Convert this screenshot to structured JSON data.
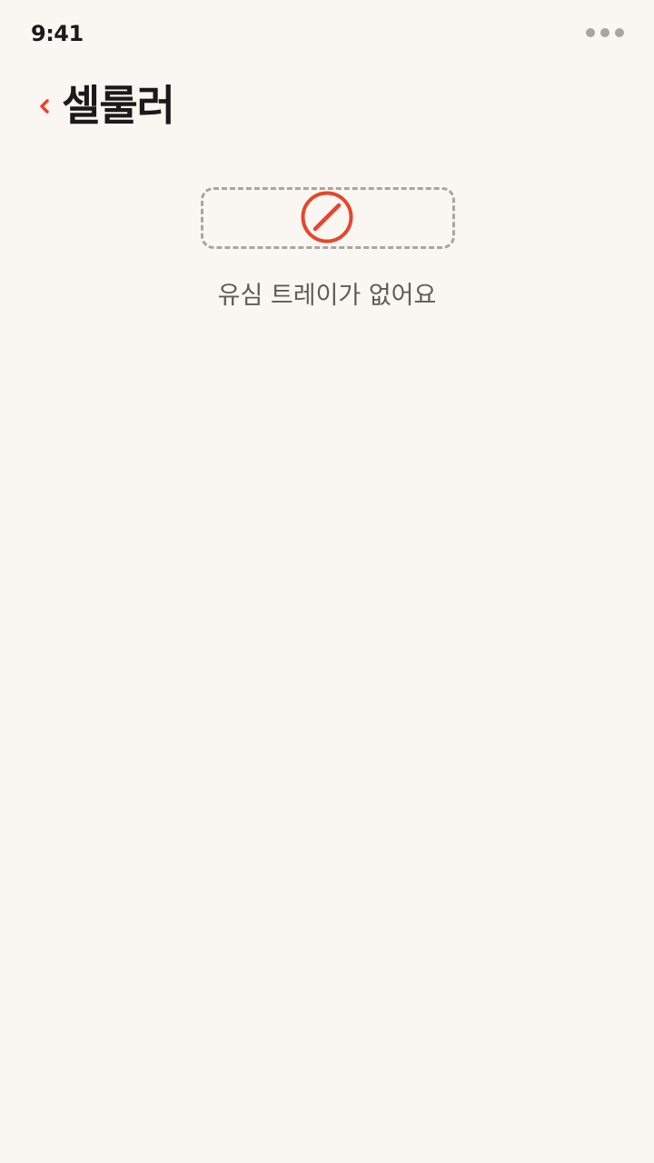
{
  "status_bar": {
    "time": "9:41",
    "more_icon": "more-dots-icon"
  },
  "header": {
    "back_icon": "chevron-left-icon",
    "title": "셀룰러"
  },
  "empty_state": {
    "icon": "no-sim-prohibited-icon",
    "message": "유심 트레이가 없어요"
  },
  "colors": {
    "accent": "#e8452c",
    "background": "#faf7f2",
    "muted": "#a9a6a1",
    "text": "#1c1a18",
    "secondary_text": "#5f5c58"
  }
}
